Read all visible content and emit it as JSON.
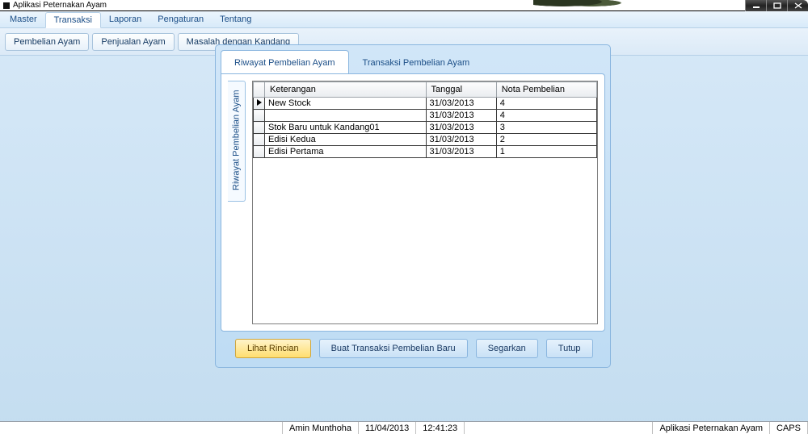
{
  "window": {
    "title": "Aplikasi Peternakan Ayam"
  },
  "menu": {
    "items": [
      "Master",
      "Transaksi",
      "Laporan",
      "Pengaturan",
      "Tentang"
    ],
    "active_index": 1
  },
  "toolbar": {
    "buttons": [
      "Pembelian Ayam",
      "Penjualan Ayam",
      "Masalah dengan Kandang"
    ]
  },
  "panel": {
    "tabs": [
      "Riwayat Pembelian Ayam",
      "Transaksi Pembelian Ayam"
    ],
    "active_tab": 0,
    "side_tab": "Riwayat Pembelian Ayam",
    "grid": {
      "columns": [
        "Keterangan",
        "Tanggal",
        "Nota Pembelian"
      ],
      "rows": [
        {
          "selected": true,
          "cells": [
            "New Stock",
            "31/03/2013",
            "4"
          ]
        },
        {
          "selected": false,
          "cells": [
            "",
            "31/03/2013",
            "4"
          ]
        },
        {
          "selected": false,
          "cells": [
            "Stok Baru untuk Kandang01",
            "31/03/2013",
            "3"
          ]
        },
        {
          "selected": false,
          "cells": [
            "Edisi Kedua",
            "31/03/2013",
            "2"
          ]
        },
        {
          "selected": false,
          "cells": [
            "Edisi Pertama",
            "31/03/2013",
            "1"
          ]
        }
      ]
    },
    "buttons": {
      "detail": "Lihat Rincian",
      "new": "Buat Transaksi Pembelian Baru",
      "refresh": "Segarkan",
      "close": "Tutup"
    }
  },
  "statusbar": {
    "user": "Amin Munthoha",
    "date": "11/04/2013",
    "time": "12:41:23",
    "app": "Aplikasi Peternakan Ayam",
    "caps": "CAPS"
  }
}
